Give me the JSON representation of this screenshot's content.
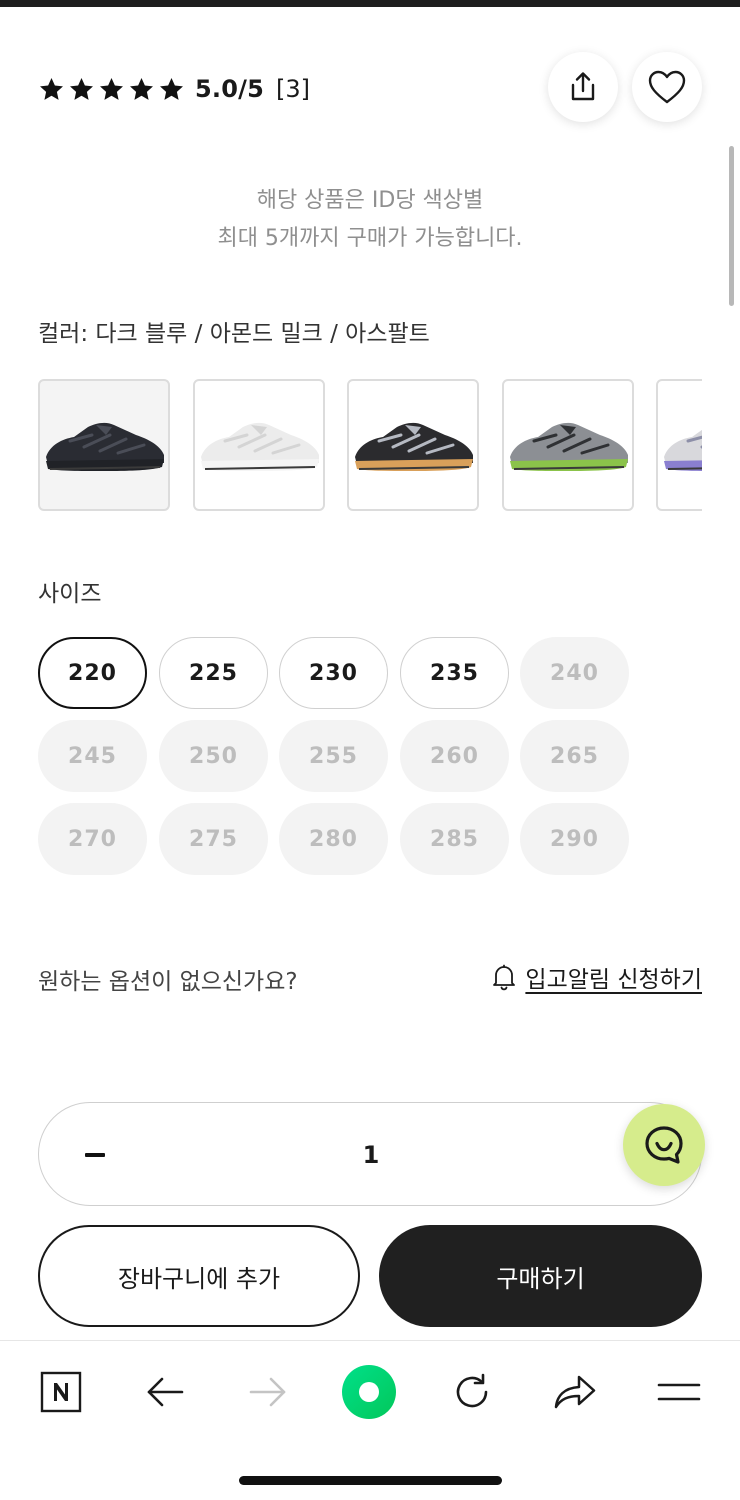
{
  "rating": {
    "stars": 5,
    "score_text": "5.0/5",
    "review_count": "[3]"
  },
  "header_actions": {
    "share_icon": "share-icon",
    "wishlist_icon": "heart-icon"
  },
  "notice": {
    "line1": "해당 상품은 ID당 색상별",
    "line2": "최대 5개까지 구매가 가능합니다."
  },
  "color": {
    "label": "컬러: 다크 블루 / 아몬드 밀크 / 아스팔트",
    "swatches": [
      {
        "name": "black",
        "selected": true,
        "upper": "#2a2c33",
        "accent": "#4a4d57",
        "sole": "#202227"
      },
      {
        "name": "white",
        "selected": false,
        "upper": "#ececec",
        "accent": "#d4d4d4",
        "sole": "#f5f5f5"
      },
      {
        "name": "black-gold",
        "selected": false,
        "upper": "#2b2b2e",
        "accent": "#b5b9c2",
        "sole": "#d9a05a"
      },
      {
        "name": "grey-lime",
        "selected": false,
        "upper": "#8c8f94",
        "accent": "#2f3134",
        "sole": "#8bc34a"
      },
      {
        "name": "white-lavender",
        "selected": false,
        "upper": "#d8d8dc",
        "accent": "#8d8fa8",
        "sole": "#8a7fd0"
      }
    ]
  },
  "size": {
    "label": "사이즈",
    "options": [
      {
        "value": "220",
        "available": true,
        "selected": true
      },
      {
        "value": "225",
        "available": true,
        "selected": false
      },
      {
        "value": "230",
        "available": true,
        "selected": false
      },
      {
        "value": "235",
        "available": true,
        "selected": false
      },
      {
        "value": "240",
        "available": false,
        "selected": false
      },
      {
        "value": "245",
        "available": false,
        "selected": false
      },
      {
        "value": "250",
        "available": false,
        "selected": false
      },
      {
        "value": "255",
        "available": false,
        "selected": false
      },
      {
        "value": "260",
        "available": false,
        "selected": false
      },
      {
        "value": "265",
        "available": false,
        "selected": false
      },
      {
        "value": "270",
        "available": false,
        "selected": false
      },
      {
        "value": "275",
        "available": false,
        "selected": false
      },
      {
        "value": "280",
        "available": false,
        "selected": false
      },
      {
        "value": "285",
        "available": false,
        "selected": false
      },
      {
        "value": "290",
        "available": false,
        "selected": false
      }
    ]
  },
  "restock": {
    "question": "원하는 옵션이 없으신가요?",
    "link": "입고알림 신청하기",
    "icon": "bell-icon"
  },
  "quantity": {
    "value": "1",
    "minus_icon": "minus-icon"
  },
  "chat": {
    "icon": "chat-smile-icon",
    "color": "#d6ec8c"
  },
  "actions": {
    "cart_label": "장바구니에 추가",
    "buy_label": "구매하기"
  },
  "bottom_nav": {
    "items": [
      "naver-home-icon",
      "back-arrow-icon",
      "forward-arrow-icon",
      "green-dot-icon",
      "refresh-icon",
      "share-arrow-icon",
      "menu-icon"
    ],
    "accent": "#03c75a"
  }
}
